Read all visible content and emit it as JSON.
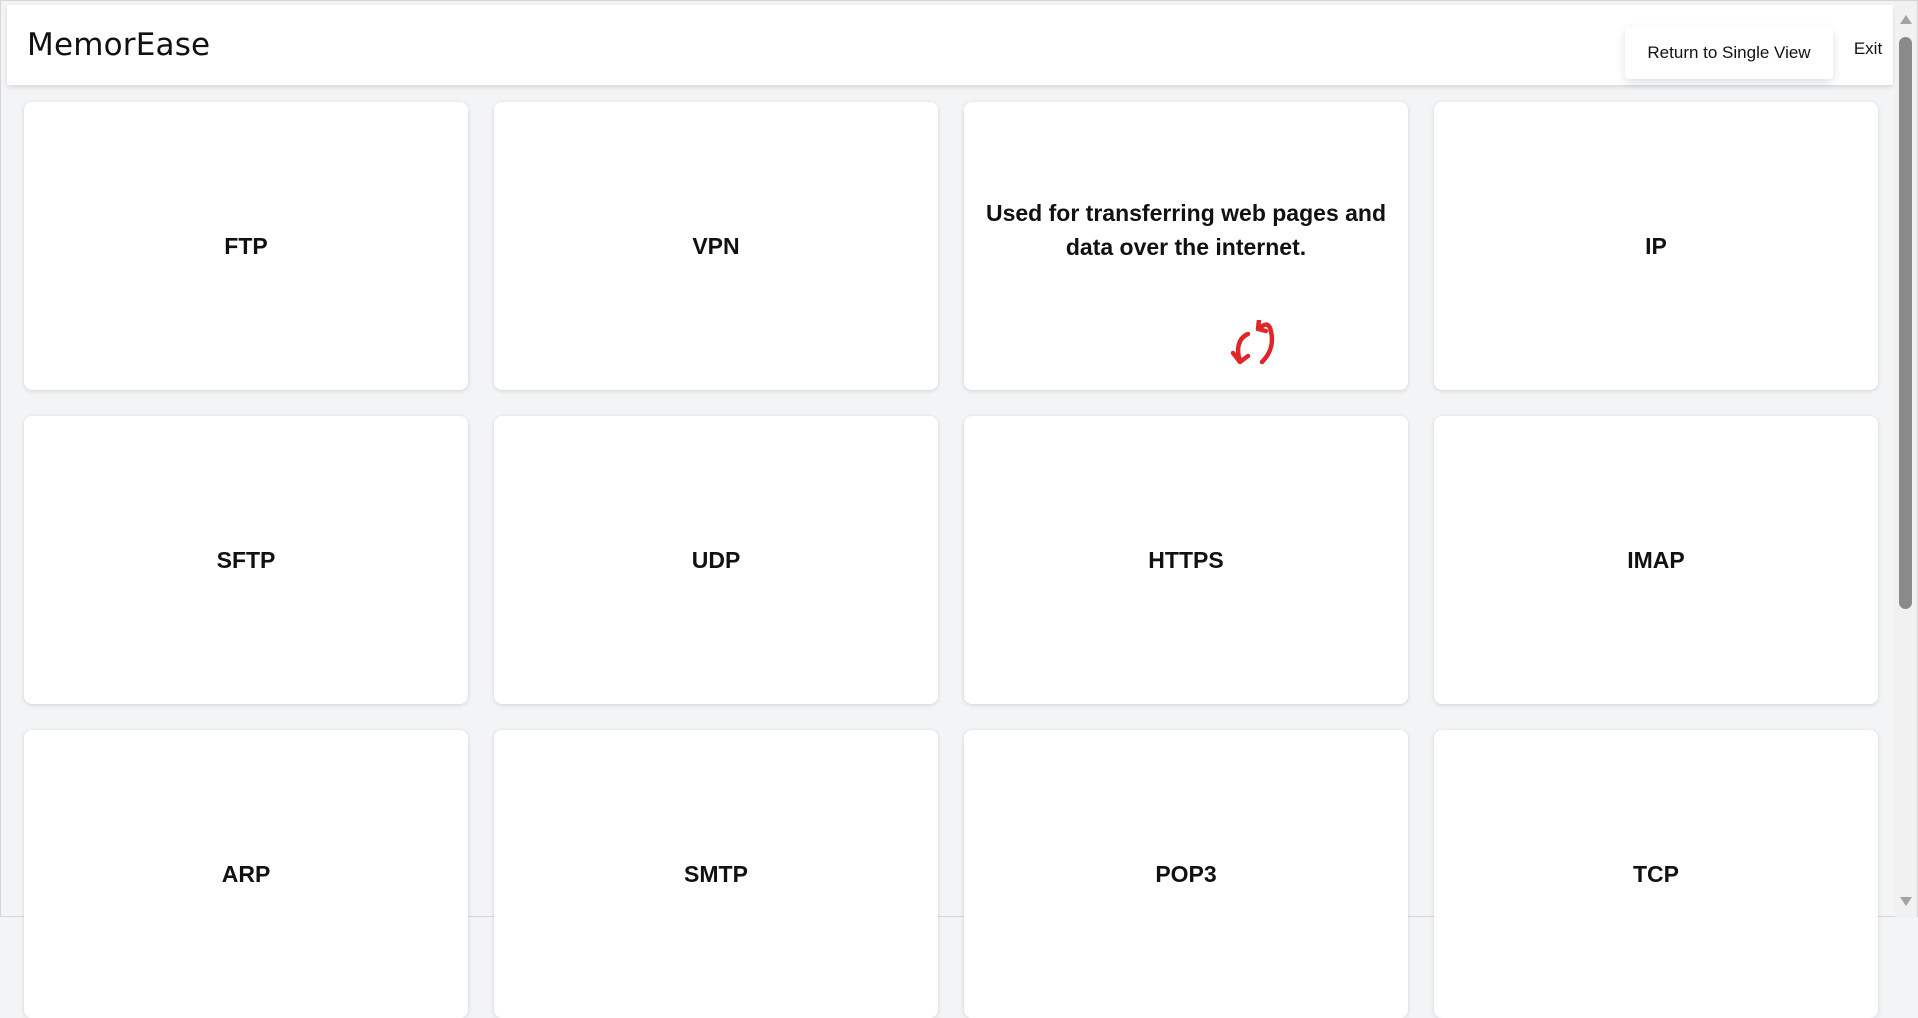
{
  "app": {
    "title": "MemorEase"
  },
  "header": {
    "single_view_label": "Return to Single View",
    "exit_label": "Exit"
  },
  "cards": [
    {
      "text": "FTP",
      "flipped": false
    },
    {
      "text": "VPN",
      "flipped": false
    },
    {
      "text": "Used for transferring web pages and data over the internet.",
      "flipped": true
    },
    {
      "text": "IP",
      "flipped": false
    },
    {
      "text": "SFTP",
      "flipped": false
    },
    {
      "text": "UDP",
      "flipped": false
    },
    {
      "text": "HTTPS",
      "flipped": false
    },
    {
      "text": "IMAP",
      "flipped": false
    },
    {
      "text": "ARP",
      "flipped": false
    },
    {
      "text": "SMTP",
      "flipped": false
    },
    {
      "text": "POP3",
      "flipped": false
    },
    {
      "text": "TCP",
      "flipped": false
    }
  ],
  "icons": {
    "flip": "flip-arrows-icon"
  },
  "colors": {
    "flip_icon": "#e0262b",
    "background": "#f3f4f6",
    "card": "#ffffff"
  }
}
